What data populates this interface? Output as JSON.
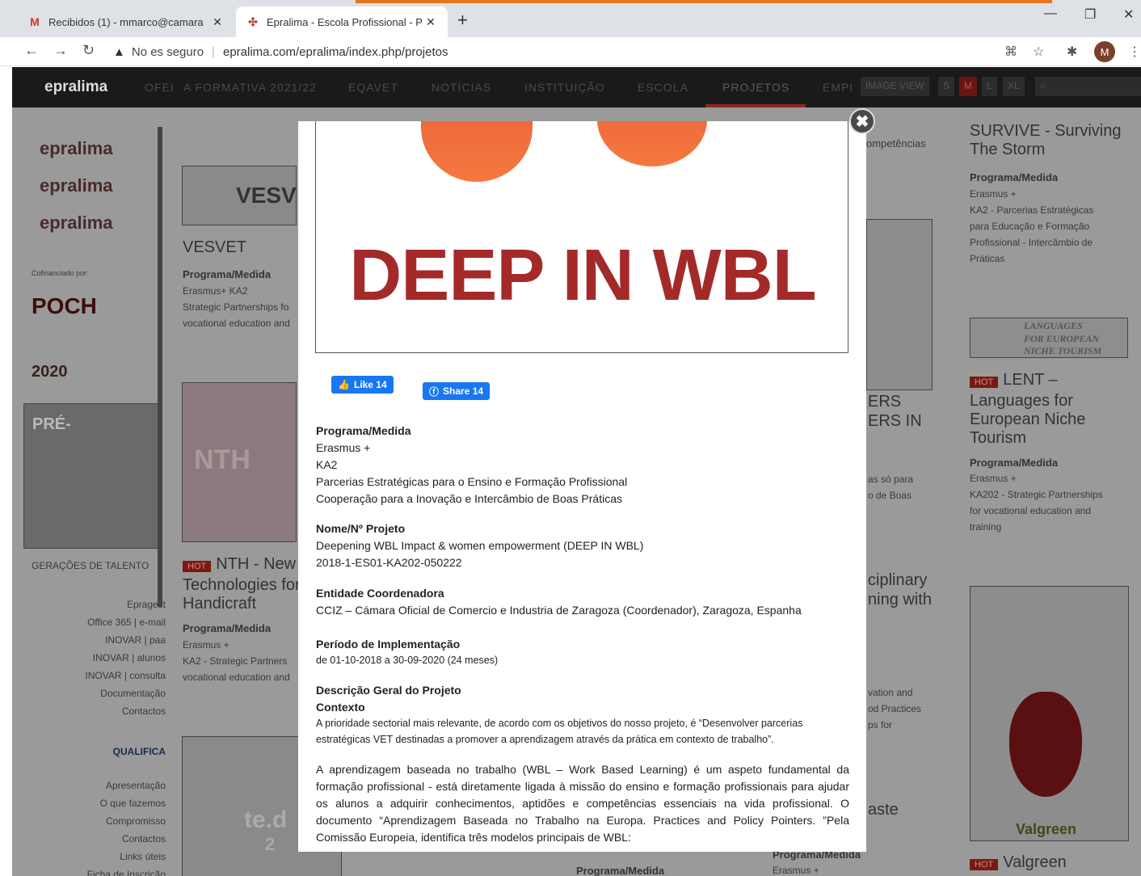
{
  "browser": {
    "tabs": [
      {
        "title": "Recibidos (1) - mmarco@camara",
        "favicon": "M",
        "active": false
      },
      {
        "title": "Epralima - Escola Profissional - P",
        "favicon": "✣",
        "active": true
      }
    ],
    "new_tab": "+",
    "omnibox": {
      "security": "No es seguro",
      "url": "epralima.com/epralima/index.php/projetos"
    },
    "profile_initial": "M",
    "colors": {
      "tab_accent": "#e3761f",
      "tabstrip": "#dee1e6"
    }
  },
  "site": {
    "logo": "epralima",
    "nav": [
      {
        "label": "OFEI"
      },
      {
        "label": "A FORMATIVA 2021/22"
      },
      {
        "label": "EQAVET"
      },
      {
        "label": "NOTÍCIAS"
      },
      {
        "label": "INSTITUIÇÃO"
      },
      {
        "label": "ESCOLA"
      },
      {
        "label": "PROJETOS"
      },
      {
        "label": "EMPI"
      }
    ],
    "image_view": "IMAGE VIEW",
    "size_buttons": [
      "S",
      "M",
      "L",
      "XL"
    ],
    "sidebar": {
      "brands": [
        "epralima",
        "epralima",
        "epralima"
      ],
      "cofinanciado": "Cofinanciado por:",
      "poch": "POCH",
      "year": "2020",
      "pre": "PRÉ-",
      "geracoes": "GERAÇÕES DE TALENTO",
      "links_a": [
        "Epragest",
        "Office 365 | e-mail",
        "INOVAR | paa",
        "INOVAR | alunos",
        "INOVAR | consulta",
        "Documentação",
        "Contactos"
      ],
      "qualifica": "QUALIFICA",
      "links_b": [
        "Apresentação",
        "O que fazemos",
        "Compromisso",
        "Contactos",
        "Links úteis",
        "Ficha de Inscrição"
      ]
    },
    "cards": {
      "vesvet_logo": "VESV",
      "vesvet_title": "VESVET",
      "vesvet_prog": "Programa/Medida",
      "vesvet_lines": [
        "Erasmus+ KA2",
        "Strategic Partnerships fo",
        "vocational education and"
      ],
      "nth_title_a": "NTH - New",
      "nth_title_b": "Technologies for",
      "nth_title_c": "Handicraft",
      "hot": "HOT",
      "nth_prog": "Programa/Medida",
      "nth_lines": [
        "Erasmus +",
        "KA2 - Strategic Partners",
        "vocational education and"
      ],
      "ted_text": "te.d",
      "ted_num": "2",
      "mid_comp": "ompetências",
      "mid_ers_a": "ERS",
      "mid_ers_b": "ERS IN",
      "mid_lines": [
        "as só para",
        "o de Boas"
      ],
      "mid_cipl_a": "ciplinary",
      "mid_cipl_b": "ning with",
      "mid_lines2": [
        "vation and",
        "od Practices",
        "ps for"
      ],
      "mid_waste": "aste",
      "bottom_prog_a": "Programa/Medida",
      "bottom_prog_b": "Programa/Medida",
      "bottom_erasmus": "Erasmus +",
      "survive_title": "SURVIVE - Surviving The Storm",
      "survive_prog": "Programa/Medida",
      "survive_lines": [
        "Erasmus +",
        "KA2 - Parcerias Estratégicas",
        "para Educação e Formação",
        "Profissional - Intercâmbio de",
        "Práticas"
      ],
      "lent_banner_a": "LANGUAGES",
      "lent_banner_b": "FOR EUROPEAN",
      "lent_banner_c": "NICHE TOURISM",
      "lent_title": "LENT – Languages for European Niche Tourism",
      "lent_prog": "Programa/Medida",
      "lent_lines": [
        "Erasmus +",
        "KA202 - Strategic Partnerships",
        "for vocational education and",
        "training"
      ],
      "valgreen_label": "Valgreen",
      "valgreen_title": "Valgreen"
    }
  },
  "modal": {
    "close": "✖",
    "hero_text": "DEEP IN WBL",
    "like_label": "Like 14",
    "share_label": "Share 14",
    "programa_head": "Programa/Medida",
    "programa_lines": [
      "Erasmus +",
      "KA2",
      "Parcerias Estratégicas para o Ensino e Formação Profissional",
      "Cooperação para a Inovação e Intercâmbio de Boas Práticas"
    ],
    "nome_head": "Nome/Nº Projeto",
    "nome_lines": [
      "Deepening WBL Impact & women empowerment (DEEP IN WBL)",
      "2018-1-ES01-KA202-050222"
    ],
    "entidade_head": "Entidade Coordenadora",
    "entidade_line": "CCIZ – Cámara Oficial de Comercio e Industria de Zaragoza (Coordenador), Zaragoza, Espanha",
    "periodo_head": "Período de Implementação",
    "periodo_line": "de  01-10-2018  a 30-09-2020 (24 meses)",
    "descricao_head": "Descrição Geral do Projeto",
    "contexto_head": "Contexto",
    "contexto_lines": [
      "A prioridade sectorial mais relevante, de acordo com os objetivos do nosso projeto, é “Desenvolver parcerias",
      "estratégicas VET destinadas a promover a aprendizagem através da prática em contexto de trabalho”."
    ],
    "para2": "A aprendizagem baseada no trabalho (WBL – Work Based Learning) é um aspeto fundamental da formação profissional - está diretamente ligada à missão do ensino e formação profissionais para ajudar os alunos a adquirir conhecimentos, aptidões e competências essenciais na vida profissional. O documento “Aprendizagem Baseada no Trabalho na Europa. Practices and Policy Pointers. ”Pela Comissão Europeia, identifica três modelos principais de WBL:"
  }
}
